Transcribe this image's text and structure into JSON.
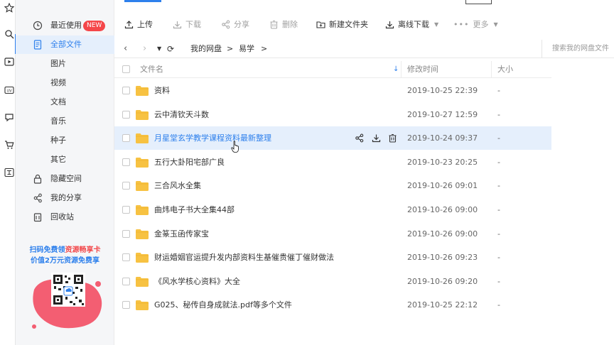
{
  "sidebar": {
    "items": [
      {
        "label": "最近使用",
        "badge": "NEW",
        "icon": "clock-icon"
      },
      {
        "label": "全部文件",
        "icon": "document-icon",
        "active": true
      },
      {
        "label": "图片"
      },
      {
        "label": "视频"
      },
      {
        "label": "文档"
      },
      {
        "label": "音乐"
      },
      {
        "label": "种子"
      },
      {
        "label": "其它"
      },
      {
        "label": "隐藏空间",
        "icon": "lock-icon"
      },
      {
        "label": "我的分享",
        "icon": "share-icon"
      },
      {
        "label": "回收站",
        "icon": "trash-icon"
      }
    ],
    "promo_line1_a": "扫码免费领",
    "promo_line1_b": "资源畅享卡",
    "promo_line2": "价值2万元资源免费享"
  },
  "toolbar": {
    "upload": "上传",
    "download": "下载",
    "share": "分享",
    "delete": "删除",
    "new_folder": "新建文件夹",
    "offline_download": "离线下载",
    "more": "更多"
  },
  "path": {
    "root": "我的网盘",
    "sep": ">",
    "current": "易学",
    "search_placeholder": "搜索我的网盘文件"
  },
  "table": {
    "columns": {
      "name": "文件名",
      "modified": "修改时间",
      "size": "大小"
    },
    "rows": [
      {
        "name": "资料",
        "modified": "2019-10-25 22:39",
        "size": "-"
      },
      {
        "name": "云中清钦天斗数",
        "modified": "2019-10-27 12:59",
        "size": "-"
      },
      {
        "name": "月星堂玄学教学课程资料最新整理",
        "modified": "2019-10-24 09:37",
        "size": "-",
        "hover": true
      },
      {
        "name": "五行大卦阳宅部广良",
        "modified": "2019-10-23 20:25",
        "size": "-"
      },
      {
        "name": "三合风水全集",
        "modified": "2019-10-26 09:01",
        "size": "-"
      },
      {
        "name": "曲炜电子书大全集44部",
        "modified": "2019-10-26 09:00",
        "size": "-"
      },
      {
        "name": "金篆玉函传家宝",
        "modified": "2019-10-26 09:00",
        "size": "-"
      },
      {
        "name": "财运婚姻官运提升发内部资料生基催贵催丁催财做法",
        "modified": "2019-10-26 09:23",
        "size": "-"
      },
      {
        "name": "《风水学核心资料》大全",
        "modified": "2019-10-26 09:20",
        "size": "-"
      },
      {
        "name": "G025、秘传自身成就法.pdf等多个文件",
        "modified": "2019-10-25 22:12",
        "size": "-"
      }
    ]
  },
  "colors": {
    "accent": "#2e80ec",
    "folder": "#f7c242",
    "badge": "#f5474a",
    "hover_row": "#e5effc"
  }
}
